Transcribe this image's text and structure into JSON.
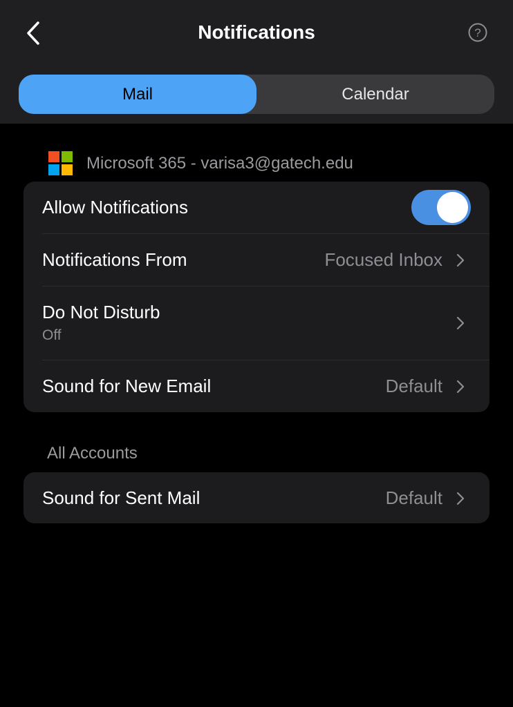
{
  "header": {
    "title": "Notifications",
    "back_icon": "chevron-left-icon",
    "help_icon": "question-circle-icon"
  },
  "segments": {
    "mail": "Mail",
    "calendar": "Calendar",
    "selected": "Mail"
  },
  "account": {
    "label": "Microsoft 365 - varisa3@gatech.edu",
    "logo_icon": "microsoft-logo-icon",
    "logo_colors": [
      "#f25022",
      "#7fba00",
      "#00a4ef",
      "#ffb900"
    ]
  },
  "settings": {
    "allow_notifications": {
      "label": "Allow Notifications",
      "enabled": true
    },
    "notifications_from": {
      "label": "Notifications From",
      "value": "Focused Inbox"
    },
    "do_not_disturb": {
      "label": "Do Not Disturb",
      "sublabel": "Off"
    },
    "sound_new_email": {
      "label": "Sound for New Email",
      "value": "Default"
    }
  },
  "all_accounts": {
    "header": "All Accounts",
    "sound_sent_mail": {
      "label": "Sound for Sent Mail",
      "value": "Default"
    }
  },
  "colors": {
    "accent": "#4da3f5",
    "toggle_on": "#4a90e2",
    "header_bg": "#1f1f21",
    "card_bg": "#1c1c1e",
    "secondary_text": "#8e8e93"
  }
}
